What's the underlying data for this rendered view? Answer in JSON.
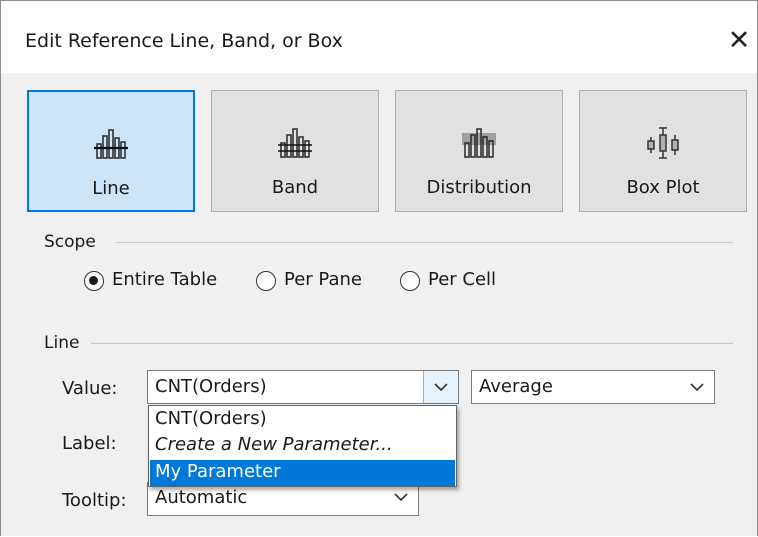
{
  "dialog": {
    "title": "Edit Reference Line, Band, or Box",
    "close_icon": "close-icon"
  },
  "type_buttons": [
    {
      "label": "Line",
      "icon": "reference-line-icon",
      "selected": true
    },
    {
      "label": "Band",
      "icon": "reference-band-icon",
      "selected": false
    },
    {
      "label": "Distribution",
      "icon": "distribution-icon",
      "selected": false
    },
    {
      "label": "Box Plot",
      "icon": "box-plot-icon",
      "selected": false
    }
  ],
  "scope": {
    "label": "Scope",
    "options": [
      {
        "label": "Entire Table",
        "selected": true
      },
      {
        "label": "Per Pane",
        "selected": false
      },
      {
        "label": "Per Cell",
        "selected": false
      }
    ]
  },
  "line": {
    "label": "Line",
    "value_label": "Value:",
    "value_selected": "CNT(Orders)",
    "aggregation": "Average",
    "label_label": "Label:",
    "tooltip_label": "Tooltip:",
    "tooltip_value": "Automatic"
  },
  "value_dropdown": {
    "options": [
      "CNT(Orders)",
      "Create a New Parameter...",
      "My Parameter"
    ],
    "highlighted": "My Parameter"
  },
  "colors": {
    "selected_fill": "#cce4f7",
    "selected_border": "#0078d7",
    "highlight": "#0078d7"
  }
}
